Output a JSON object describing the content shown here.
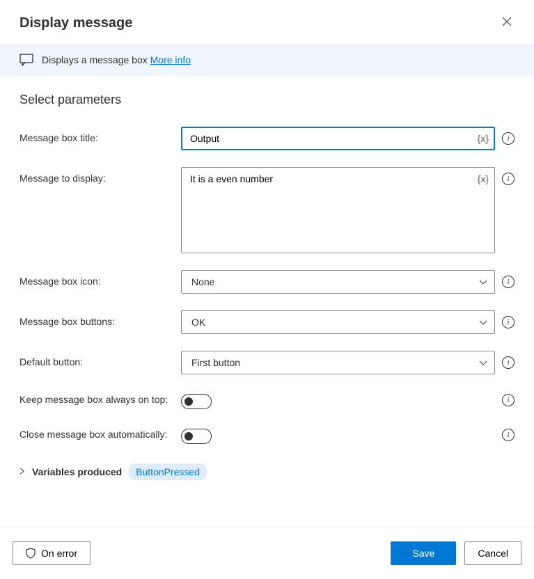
{
  "header": {
    "title": "Display message"
  },
  "banner": {
    "text": "Displays a message box ",
    "linkText": "More info"
  },
  "section": {
    "title": "Select parameters"
  },
  "params": {
    "title": {
      "label": "Message box title:",
      "value": "Output"
    },
    "message": {
      "label": "Message to display:",
      "value": "It is a even number"
    },
    "icon": {
      "label": "Message box icon:",
      "value": "None"
    },
    "buttons": {
      "label": "Message box buttons:",
      "value": "OK"
    },
    "defaultButton": {
      "label": "Default button:",
      "value": "First button"
    },
    "alwaysOnTop": {
      "label": "Keep message box always on top:",
      "value": false
    },
    "autoClose": {
      "label": "Close message box automatically:",
      "value": false
    }
  },
  "variables": {
    "label": "Variables produced",
    "badge": "ButtonPressed"
  },
  "footer": {
    "onError": "On error",
    "save": "Save",
    "cancel": "Cancel"
  },
  "tokens": {
    "varInsert": "{x}"
  }
}
